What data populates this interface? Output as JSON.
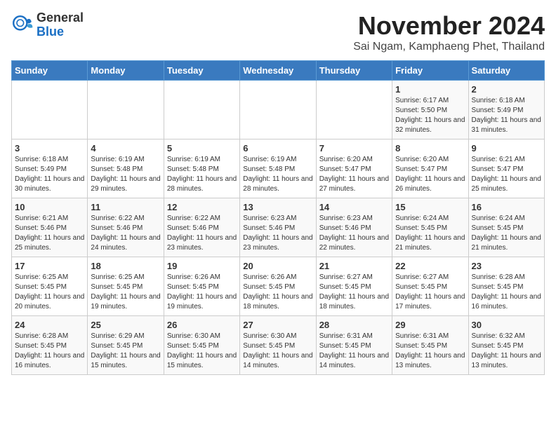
{
  "logo": {
    "general": "General",
    "blue": "Blue"
  },
  "title": "November 2024",
  "subtitle": "Sai Ngam, Kamphaeng Phet, Thailand",
  "weekdays": [
    "Sunday",
    "Monday",
    "Tuesday",
    "Wednesday",
    "Thursday",
    "Friday",
    "Saturday"
  ],
  "weeks": [
    [
      {
        "day": "",
        "info": ""
      },
      {
        "day": "",
        "info": ""
      },
      {
        "day": "",
        "info": ""
      },
      {
        "day": "",
        "info": ""
      },
      {
        "day": "",
        "info": ""
      },
      {
        "day": "1",
        "info": "Sunrise: 6:17 AM\nSunset: 5:50 PM\nDaylight: 11 hours and 32 minutes."
      },
      {
        "day": "2",
        "info": "Sunrise: 6:18 AM\nSunset: 5:49 PM\nDaylight: 11 hours and 31 minutes."
      }
    ],
    [
      {
        "day": "3",
        "info": "Sunrise: 6:18 AM\nSunset: 5:49 PM\nDaylight: 11 hours and 30 minutes."
      },
      {
        "day": "4",
        "info": "Sunrise: 6:19 AM\nSunset: 5:48 PM\nDaylight: 11 hours and 29 minutes."
      },
      {
        "day": "5",
        "info": "Sunrise: 6:19 AM\nSunset: 5:48 PM\nDaylight: 11 hours and 28 minutes."
      },
      {
        "day": "6",
        "info": "Sunrise: 6:19 AM\nSunset: 5:48 PM\nDaylight: 11 hours and 28 minutes."
      },
      {
        "day": "7",
        "info": "Sunrise: 6:20 AM\nSunset: 5:47 PM\nDaylight: 11 hours and 27 minutes."
      },
      {
        "day": "8",
        "info": "Sunrise: 6:20 AM\nSunset: 5:47 PM\nDaylight: 11 hours and 26 minutes."
      },
      {
        "day": "9",
        "info": "Sunrise: 6:21 AM\nSunset: 5:47 PM\nDaylight: 11 hours and 25 minutes."
      }
    ],
    [
      {
        "day": "10",
        "info": "Sunrise: 6:21 AM\nSunset: 5:46 PM\nDaylight: 11 hours and 25 minutes."
      },
      {
        "day": "11",
        "info": "Sunrise: 6:22 AM\nSunset: 5:46 PM\nDaylight: 11 hours and 24 minutes."
      },
      {
        "day": "12",
        "info": "Sunrise: 6:22 AM\nSunset: 5:46 PM\nDaylight: 11 hours and 23 minutes."
      },
      {
        "day": "13",
        "info": "Sunrise: 6:23 AM\nSunset: 5:46 PM\nDaylight: 11 hours and 23 minutes."
      },
      {
        "day": "14",
        "info": "Sunrise: 6:23 AM\nSunset: 5:46 PM\nDaylight: 11 hours and 22 minutes."
      },
      {
        "day": "15",
        "info": "Sunrise: 6:24 AM\nSunset: 5:45 PM\nDaylight: 11 hours and 21 minutes."
      },
      {
        "day": "16",
        "info": "Sunrise: 6:24 AM\nSunset: 5:45 PM\nDaylight: 11 hours and 21 minutes."
      }
    ],
    [
      {
        "day": "17",
        "info": "Sunrise: 6:25 AM\nSunset: 5:45 PM\nDaylight: 11 hours and 20 minutes."
      },
      {
        "day": "18",
        "info": "Sunrise: 6:25 AM\nSunset: 5:45 PM\nDaylight: 11 hours and 19 minutes."
      },
      {
        "day": "19",
        "info": "Sunrise: 6:26 AM\nSunset: 5:45 PM\nDaylight: 11 hours and 19 minutes."
      },
      {
        "day": "20",
        "info": "Sunrise: 6:26 AM\nSunset: 5:45 PM\nDaylight: 11 hours and 18 minutes."
      },
      {
        "day": "21",
        "info": "Sunrise: 6:27 AM\nSunset: 5:45 PM\nDaylight: 11 hours and 18 minutes."
      },
      {
        "day": "22",
        "info": "Sunrise: 6:27 AM\nSunset: 5:45 PM\nDaylight: 11 hours and 17 minutes."
      },
      {
        "day": "23",
        "info": "Sunrise: 6:28 AM\nSunset: 5:45 PM\nDaylight: 11 hours and 16 minutes."
      }
    ],
    [
      {
        "day": "24",
        "info": "Sunrise: 6:28 AM\nSunset: 5:45 PM\nDaylight: 11 hours and 16 minutes."
      },
      {
        "day": "25",
        "info": "Sunrise: 6:29 AM\nSunset: 5:45 PM\nDaylight: 11 hours and 15 minutes."
      },
      {
        "day": "26",
        "info": "Sunrise: 6:30 AM\nSunset: 5:45 PM\nDaylight: 11 hours and 15 minutes."
      },
      {
        "day": "27",
        "info": "Sunrise: 6:30 AM\nSunset: 5:45 PM\nDaylight: 11 hours and 14 minutes."
      },
      {
        "day": "28",
        "info": "Sunrise: 6:31 AM\nSunset: 5:45 PM\nDaylight: 11 hours and 14 minutes."
      },
      {
        "day": "29",
        "info": "Sunrise: 6:31 AM\nSunset: 5:45 PM\nDaylight: 11 hours and 13 minutes."
      },
      {
        "day": "30",
        "info": "Sunrise: 6:32 AM\nSunset: 5:45 PM\nDaylight: 11 hours and 13 minutes."
      }
    ]
  ]
}
